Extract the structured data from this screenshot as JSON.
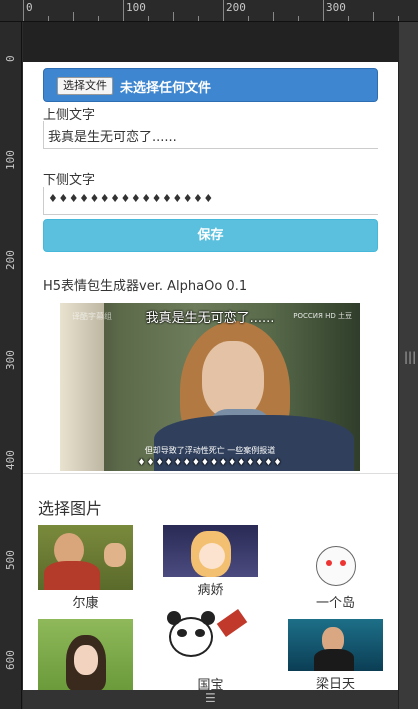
{
  "ruler": {
    "top_labels": [
      "0",
      "100",
      "200",
      "300"
    ],
    "left_labels": [
      "0",
      "100",
      "200",
      "300",
      "400",
      "500",
      "600"
    ]
  },
  "form": {
    "file_button": "选择文件",
    "file_status": "未选择任何文件",
    "top_text_label": "上侧文字",
    "top_text_value": "我真是生无可恋了......",
    "bottom_text_label": "下侧文字",
    "bottom_text_value": "♦♦♦♦♦♦♦♦♦♦♦♦♦♦♦♦",
    "save_label": "保存"
  },
  "generator": {
    "title": "H5表情包生成器ver. AlphaOo 0.1"
  },
  "meme": {
    "top_caption": "我真是生无可恋了......",
    "bottom_caption": "♦♦♦♦♦♦♦♦♦♦♦♦♦♦♦♦",
    "subtitle": "但却导致了浮动性死亡 一些案例报道",
    "watermark_left": "译酷字幕组",
    "watermark_right": "РОССИЯ HD 土豆"
  },
  "gallery": {
    "title": "选择图片",
    "items": [
      {
        "caption": "尔康"
      },
      {
        "caption": "病娇"
      },
      {
        "caption": "一个岛"
      },
      {
        "caption": ""
      },
      {
        "caption": "国宝"
      },
      {
        "caption": "梁日天"
      }
    ]
  }
}
